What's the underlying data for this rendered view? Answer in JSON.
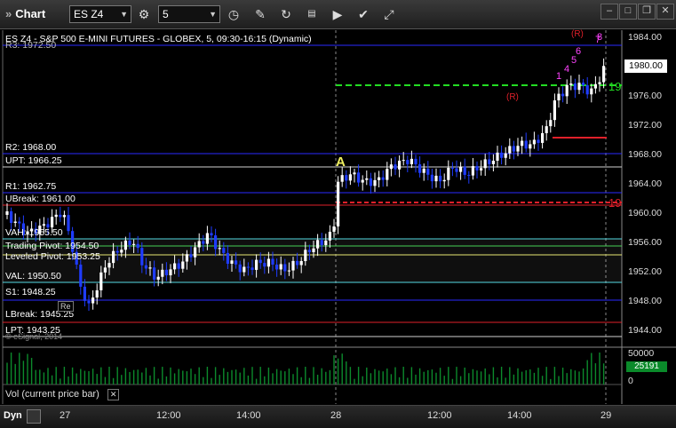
{
  "toolbar": {
    "title": "Chart",
    "symbol": "ES Z4",
    "interval": "5"
  },
  "chart": {
    "header": "ES Z4 - S&P 500 E-MINI FUTURES - GLOBEX, 5, 09:30-16:15 (Dynamic)",
    "overlap_label": "R3: 1972.50",
    "copyright": "© eSignal, 2014",
    "level_labels": [
      "R2: 1968.00",
      "UPT: 1966.25",
      "R1: 1962.75",
      "UBreak: 1961.00",
      "VAH: 1955.50",
      "Trading Pivot: 1954.50",
      "Leveled Pivot: 1953.25",
      "VAL: 1950.50",
      "S1: 1948.25",
      "LBreak: 1945.25",
      "LPT: 1943.25"
    ],
    "marker_A": "A",
    "marker_19_upper": "19",
    "marker_19_lower": "19",
    "r_label_top": "(R)",
    "r_label_mid": "(R)",
    "r_small": "Re",
    "pink_nums": [
      "7",
      "8",
      "6",
      "5",
      "4",
      "1"
    ],
    "price_axis": [
      "1984.00",
      "1980.00",
      "1976.00",
      "1972.00",
      "1968.00",
      "1964.00",
      "1960.00",
      "1956.00",
      "1952.00",
      "1948.00",
      "1944.00"
    ],
    "current_price": "1980.00",
    "vol_axis": [
      "50000",
      "0"
    ],
    "vol_current": "25191",
    "vol_label": "Vol (current price bar)",
    "x_labels": [
      "27",
      "12:00",
      "14:00",
      "28",
      "12:00",
      "14:00",
      "29"
    ],
    "bottom_mode": "Dyn"
  },
  "colors": {
    "background": "#000000",
    "up_candle": "#ffffff",
    "down_candle": "#1f3cff",
    "volume": "#0c8a2c",
    "green_dash": "#22dd22",
    "red_line": "#e0202a",
    "accent_yellow": "#f0f060"
  },
  "chart_data": {
    "type": "candlestick",
    "ylim": [
      1942,
      1986
    ],
    "vol_ylim": [
      0,
      55000
    ]
  }
}
